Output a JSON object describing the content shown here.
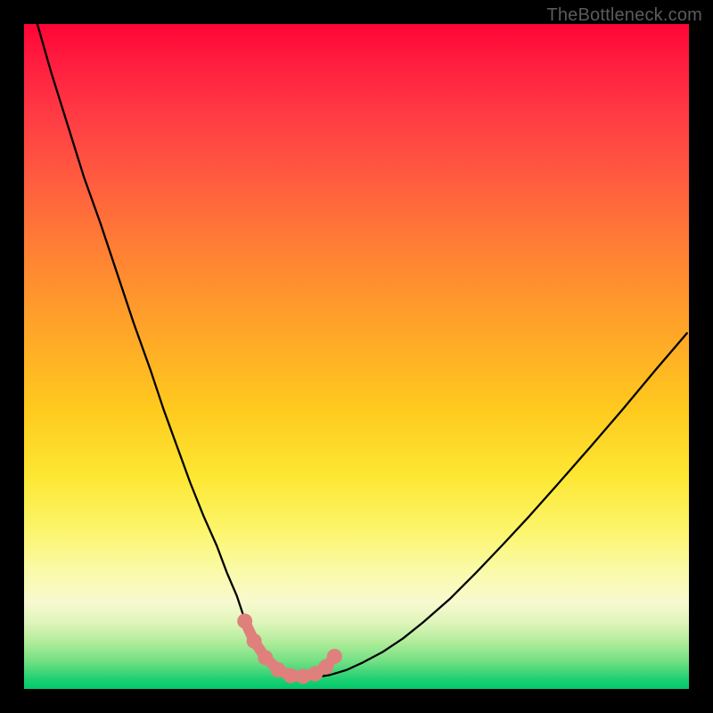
{
  "watermark": {
    "text": "TheBottleneck.com"
  },
  "colors": {
    "page_bg": "#000000",
    "curve_stroke": "#000000",
    "marker_fill": "#e0807c",
    "gradient_top": "#ff0536",
    "gradient_bottom": "#00c96c"
  },
  "chart_data": {
    "type": "line",
    "title": "",
    "xlabel": "",
    "ylabel": "",
    "xlim": [
      0,
      100
    ],
    "ylim": [
      0,
      100
    ],
    "grid": false,
    "legend": false,
    "series": [
      {
        "name": "bottleneck-curve",
        "x": [
          2,
          4,
          6.5,
          9,
          11.5,
          14,
          16.5,
          19,
          21,
          23,
          25,
          27,
          29,
          30.5,
          32,
          33,
          34,
          35,
          36,
          37,
          38,
          39.5,
          41,
          42.5,
          44,
          46,
          48.5,
          51,
          54,
          57,
          60,
          64,
          68,
          72,
          76,
          80,
          85,
          90,
          95,
          99.7
        ],
        "y": [
          100,
          93,
          85,
          77,
          70,
          62.5,
          55,
          48,
          42,
          36.5,
          31,
          26,
          21.5,
          17.5,
          14,
          11,
          8.5,
          6.5,
          5,
          3.8,
          2.9,
          2.25,
          1.85,
          1.7,
          1.8,
          2.1,
          2.85,
          4,
          5.6,
          7.6,
          10,
          13.5,
          17.5,
          21.7,
          26,
          30.5,
          36.2,
          42,
          48,
          53.5
        ]
      }
    ],
    "markers": {
      "name": "highlighted-range",
      "x": [
        33.2,
        34.6,
        36.3,
        38.2,
        40.1,
        42.0,
        43.8,
        45.4,
        46.7
      ],
      "y": [
        10.2,
        7.2,
        4.7,
        2.9,
        2.0,
        1.9,
        2.3,
        3.3,
        4.9
      ]
    },
    "annotations": []
  }
}
